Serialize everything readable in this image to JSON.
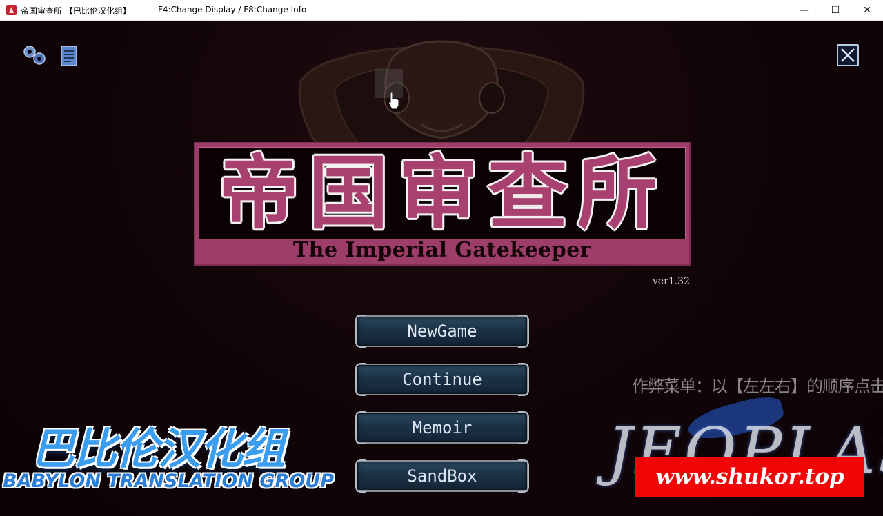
{
  "window": {
    "title": "帝国审查所 【巴比伦汉化组】",
    "hint": "F4:Change Display / F8:Change Info",
    "minimize": "—",
    "maximize": "☐",
    "close": "✕"
  },
  "logo": {
    "title_cjk": "帝国审查所",
    "subtitle": "The Imperial Gatekeeper"
  },
  "version": "ver1.32",
  "menu": {
    "new_game": "NewGame",
    "continue": "Continue",
    "memoir": "Memoir",
    "sandbox": "SandBox"
  },
  "cheat_hint": "作弊菜单：以【左左右】的顺序点击眼镜蛇的眼睛",
  "translation_group": {
    "name_cn": "巴比伦汉化组",
    "name_en": "BABYLON TRANSLATION GROUP"
  },
  "studio_logo": "JEOPLASH",
  "watermark": "www.shukor.top",
  "icons": {
    "settings": "settings-gears-icon",
    "notes": "notes-document-icon",
    "close": "close-x-icon"
  },
  "colors": {
    "logo_band": "#9c3d6a",
    "button_fill": "#1b3145",
    "watermark_bg": "#f00606"
  }
}
